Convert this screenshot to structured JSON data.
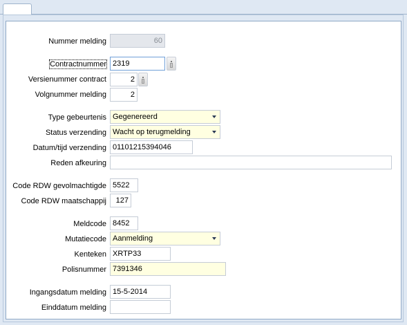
{
  "form": {
    "nummer_melding": {
      "label": "Nummer melding",
      "value": "60"
    },
    "contractnummer": {
      "label": "Contractnummer",
      "value": "2319"
    },
    "versienummer_contract": {
      "label": "Versienummer contract",
      "value": "2"
    },
    "volgnummer_melding": {
      "label": "Volgnummer melding",
      "value": "2"
    },
    "type_gebeurtenis": {
      "label": "Type gebeurtenis",
      "value": "Gegenereerd"
    },
    "status_verzending": {
      "label": "Status verzending",
      "value": "Wacht op terugmelding"
    },
    "datum_tijd_verzending": {
      "label": "Datum/tijd verzending",
      "value": "01101215394046"
    },
    "reden_afkeuring": {
      "label": "Reden afkeuring",
      "value": ""
    },
    "code_rdw_gevolmachtigde": {
      "label": "Code RDW gevolmachtigde",
      "value": "5522"
    },
    "code_rdw_maatschappij": {
      "label": "Code RDW maatschappij",
      "value": "127"
    },
    "meldcode": {
      "label": "Meldcode",
      "value": "8452"
    },
    "mutatiecode": {
      "label": "Mutatiecode",
      "value": "Aanmelding"
    },
    "kenteken": {
      "label": "Kenteken",
      "value": "XRTP33"
    },
    "polisnummer": {
      "label": "Polisnummer",
      "value": "7391346"
    },
    "ingangsdatum_melding": {
      "label": "Ingangsdatum melding",
      "value": "15-5-2014"
    },
    "einddatum_melding": {
      "label": "Einddatum melding",
      "value": ""
    }
  },
  "icons": {
    "lookup": "lookup-icon",
    "dropdown": "chevron-down-icon"
  },
  "colors": {
    "background": "#dfe8f3",
    "highlight_field": "#ffffe1",
    "disabled_field": "#e4e7ec"
  }
}
